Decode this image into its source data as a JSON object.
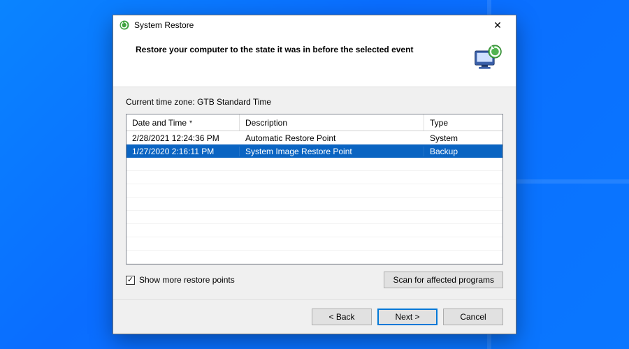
{
  "window": {
    "title": "System Restore",
    "heading": "Restore your computer to the state it was in before the selected event",
    "close_glyph": "✕"
  },
  "timezone_label": "Current time zone: GTB Standard Time",
  "columns": {
    "date": "Date and Time",
    "desc": "Description",
    "type": "Type"
  },
  "rows": [
    {
      "date": "2/28/2021 12:24:36 PM",
      "desc": "Automatic Restore Point",
      "type": "System",
      "selected": false
    },
    {
      "date": "1/27/2020 2:16:11 PM",
      "desc": "System Image Restore Point",
      "type": "Backup",
      "selected": true
    }
  ],
  "show_more": {
    "label": "Show more restore points",
    "checked": true
  },
  "scan_button": "Scan for affected programs",
  "nav": {
    "back": "< Back",
    "next": "Next >",
    "cancel": "Cancel"
  }
}
